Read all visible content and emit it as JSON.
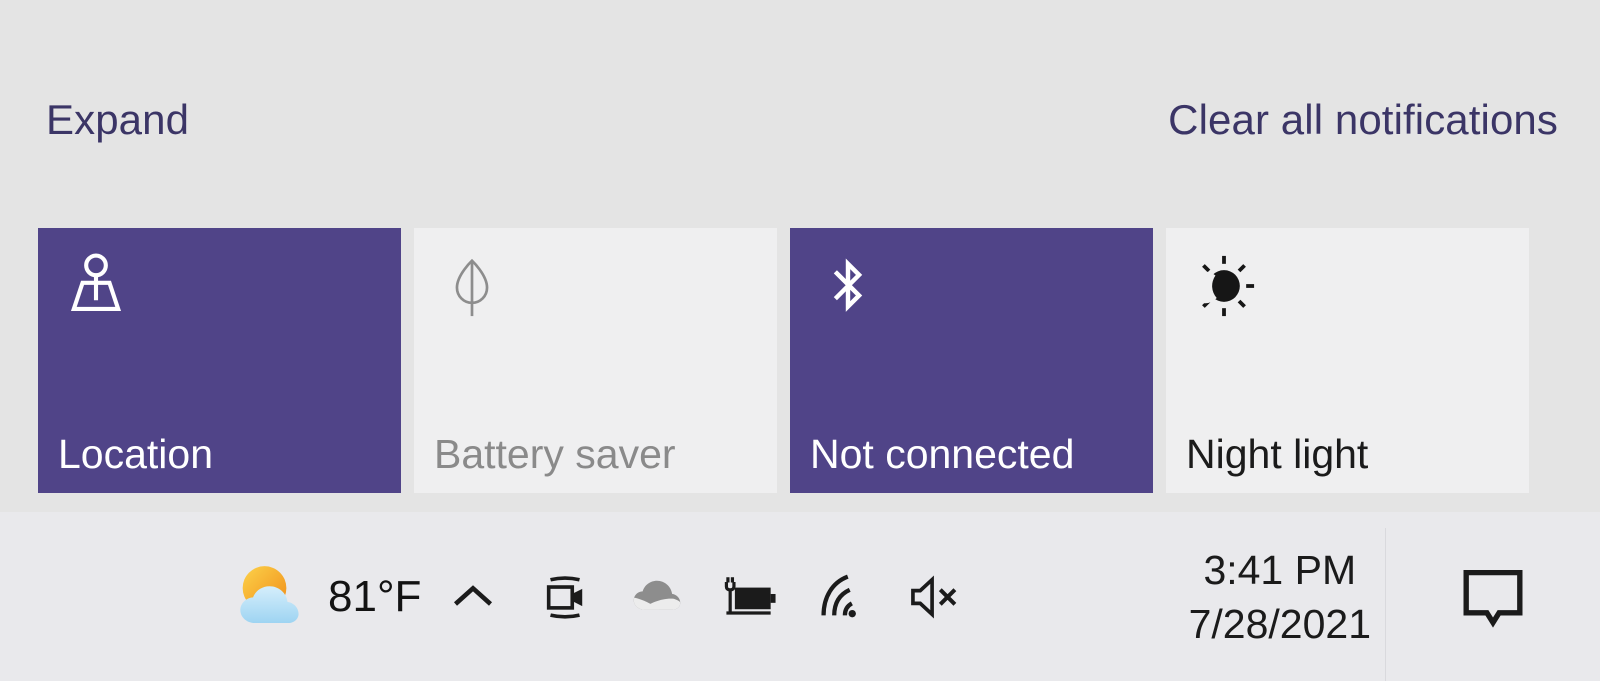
{
  "action_center": {
    "expand_label": "Expand",
    "clear_all_label": "Clear all notifications",
    "link_color": "#3b3566",
    "background_color": "#e4e4e4",
    "tile_on_color": "#504488",
    "tile_off_color": "#efeff0",
    "quick_actions": [
      {
        "label": "Location",
        "icon": "location-icon",
        "state": "on"
      },
      {
        "label": "Battery saver",
        "icon": "leaf-icon",
        "state": "off"
      },
      {
        "label": "Not connected",
        "icon": "bluetooth-icon",
        "state": "on"
      },
      {
        "label": "Night light",
        "icon": "night-light-icon",
        "state": "off"
      }
    ]
  },
  "taskbar": {
    "background_color": "#e9e9ec",
    "weather": {
      "icon": "partly-cloudy-sun-icon",
      "temperature": "81°F"
    },
    "tray_icons": [
      {
        "name": "show-hidden-icons-chevron-up-icon"
      },
      {
        "name": "camera-video-icon"
      },
      {
        "name": "onedrive-cloud-icon"
      },
      {
        "name": "battery-charging-icon"
      },
      {
        "name": "wifi-icon"
      },
      {
        "name": "volume-muted-icon"
      }
    ],
    "clock": {
      "time": "3:41 PM",
      "date": "7/28/2021"
    },
    "action_center_button_icon": "notification-speech-bubble-icon"
  }
}
